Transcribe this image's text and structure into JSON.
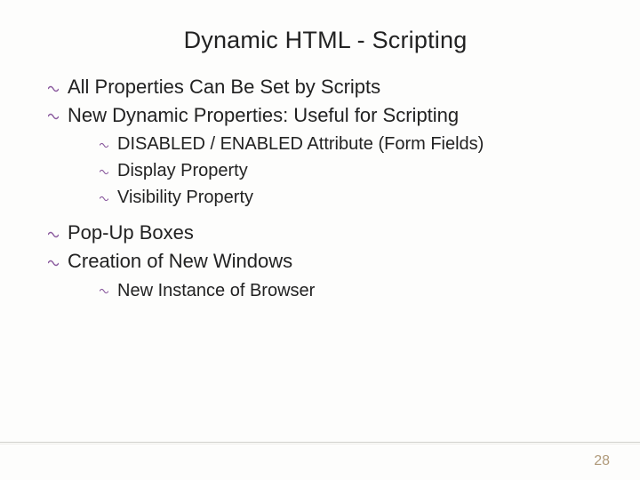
{
  "title": "Dynamic HTML - Scripting",
  "bullets": {
    "b1": "All Properties Can Be Set by Scripts",
    "b2": "New Dynamic Properties: Useful for Scripting",
    "b2_1": "DISABLED / ENABLED Attribute (Form Fields)",
    "b2_2": "Display Property",
    "b2_3": "Visibility Property",
    "b3": "Pop-Up Boxes",
    "b4": "Creation of New Windows",
    "b4_1": "New Instance of Browser"
  },
  "page_number": "28"
}
